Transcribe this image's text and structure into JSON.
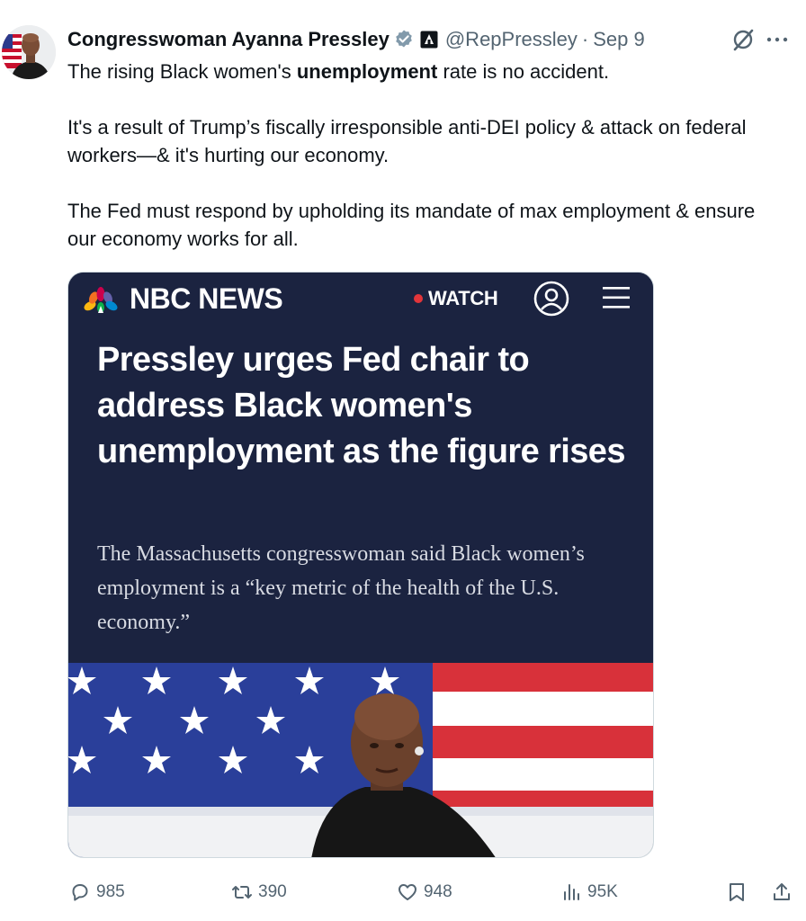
{
  "tweet": {
    "display_name": "Congresswoman Ayanna Pressley",
    "handle": "@RepPressley",
    "separator": "·",
    "date": "Sep 9",
    "body": {
      "p1_before": "The rising Black women's ",
      "p1_bold": "unemployment",
      "p1_after": " rate is no accident.",
      "p2": "It's a result of Trump’s fiscally irresponsible anti-DEI policy & attack on federal workers—& it's hurting our economy.",
      "p3": "The Fed must respond by upholding its mandate of max employment & ensure our economy works for all."
    }
  },
  "media": {
    "brand": "NBC NEWS",
    "watch_label": "WATCH",
    "headline": "Pressley urges Fed chair to address Black women's unemployment as the figure rises",
    "dek": "The Massachusetts congresswoman said Black women’s employment is a “key metric of the health of the U.S. economy.”"
  },
  "actions": {
    "replies": "985",
    "reposts": "390",
    "likes": "948",
    "views": "95K"
  },
  "icons": {
    "verified": "verified-badge-icon",
    "government": "government-affiliation-icon",
    "grok": "grok-icon",
    "more": "more-icon",
    "peacock": "nbc-peacock-icon",
    "account": "account-icon",
    "menu": "menu-icon",
    "reply": "reply-icon",
    "repost": "repost-icon",
    "like": "heart-icon",
    "views": "views-icon",
    "bookmark": "bookmark-icon",
    "share": "share-icon"
  },
  "colors": {
    "text_primary": "#0f1419",
    "text_secondary": "#536471",
    "nbc_navy": "#1b2340",
    "live_red": "#e2353a",
    "verified_gray": "#829aab"
  }
}
